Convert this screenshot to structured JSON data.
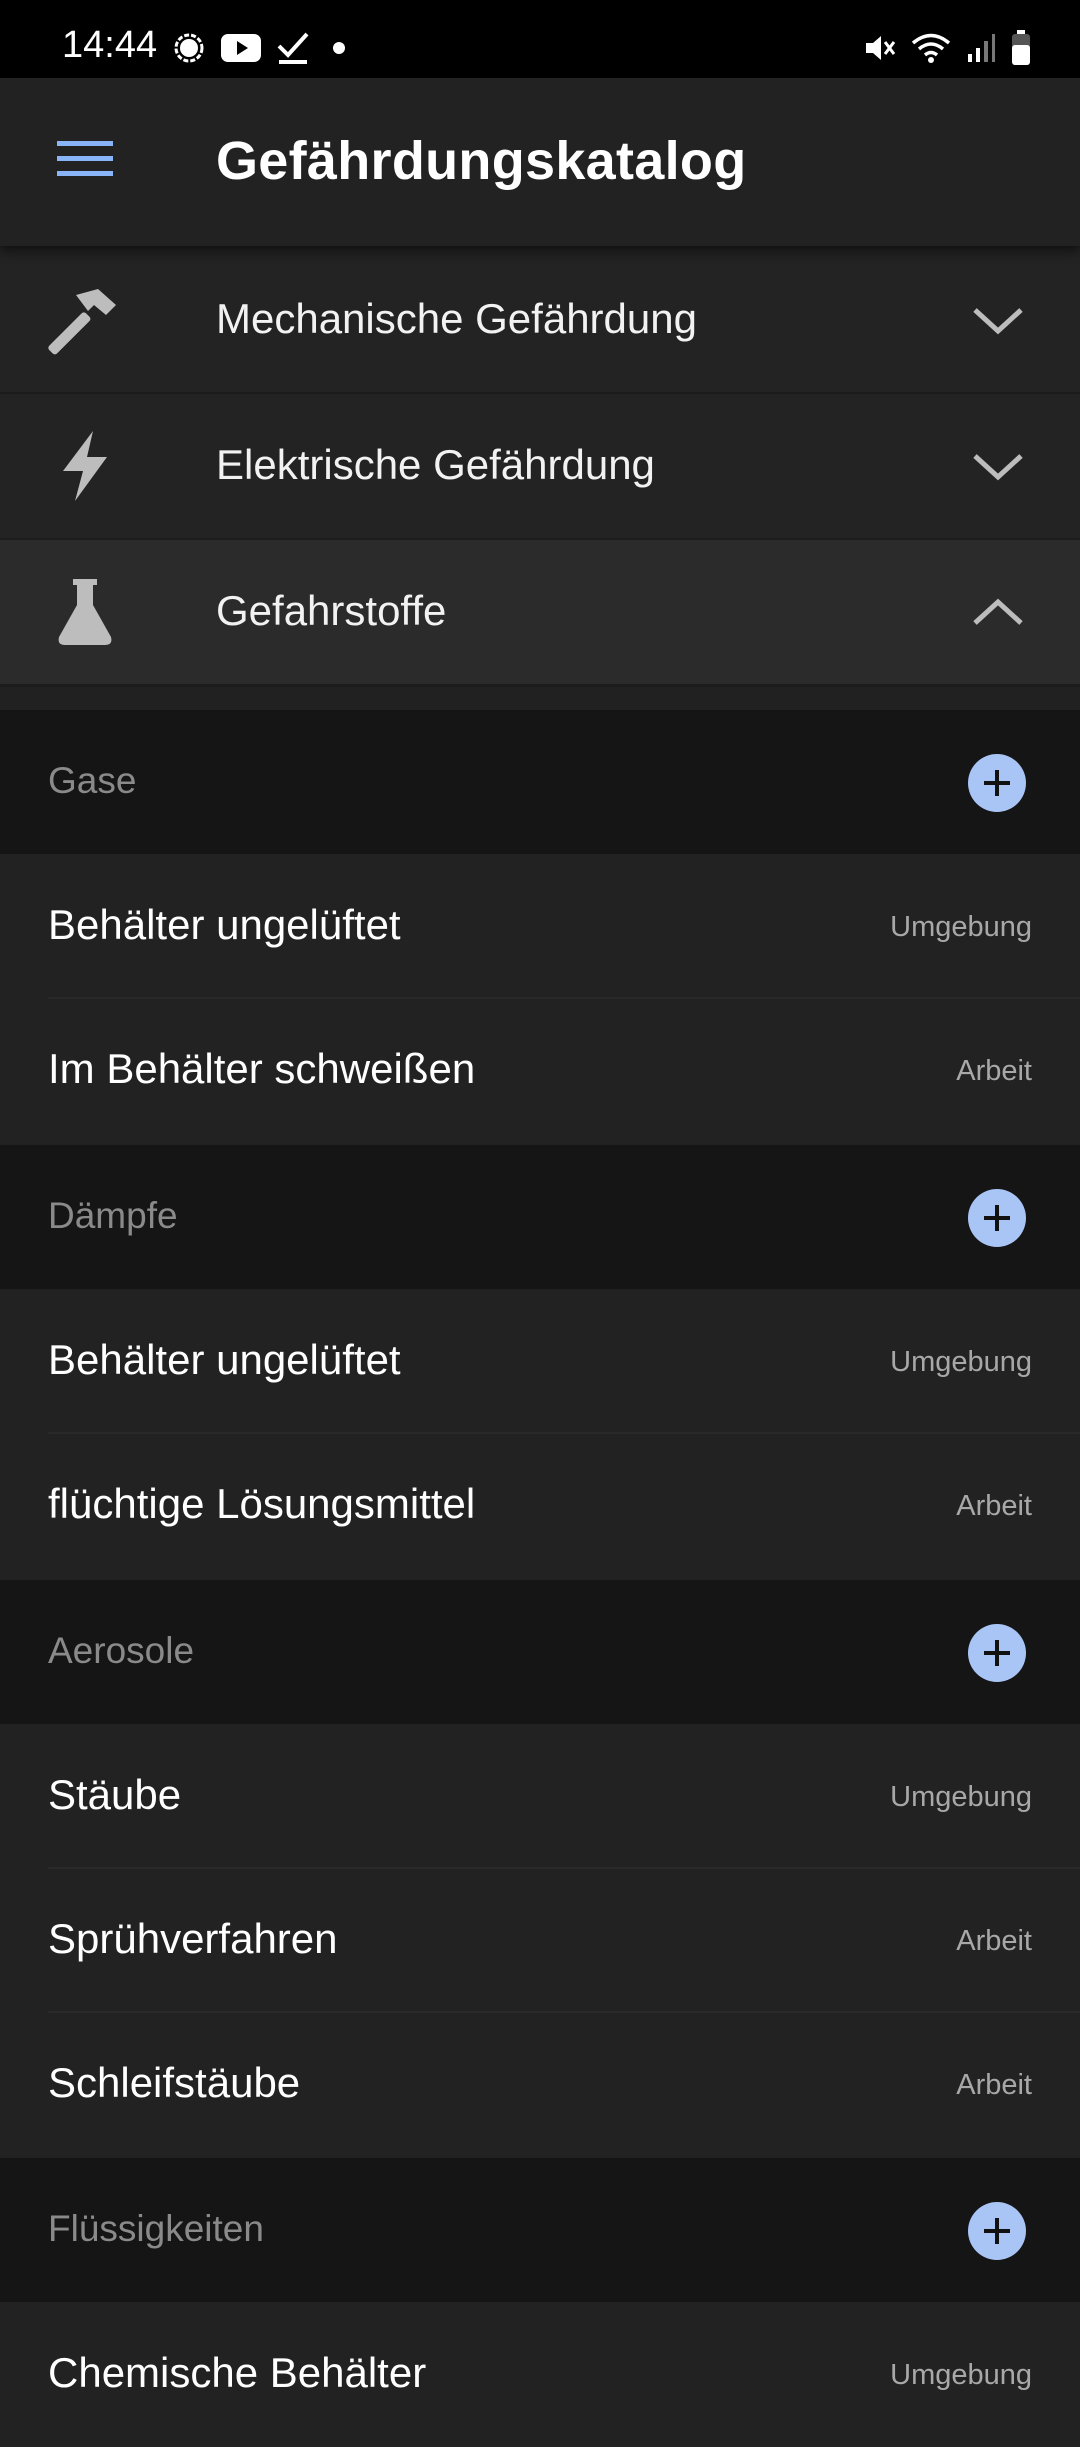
{
  "status_bar": {
    "time": "14:44",
    "left_icons": [
      "signal-messenger-icon",
      "youtube-icon",
      "check-icon",
      "dot-icon"
    ],
    "right_icons": [
      "mute-icon",
      "wifi-icon",
      "cell-signal-icon",
      "battery-icon"
    ]
  },
  "app_bar": {
    "menu_icon": "hamburger-menu-icon",
    "title": "Gefährdungskatalog",
    "accent_color": "#8ab4f8"
  },
  "categories": [
    {
      "label": "Mechanische Gefährdung",
      "icon": "hammer-icon",
      "expanded": false
    },
    {
      "label": "Elektrische Gefährdung",
      "icon": "lightning-icon",
      "expanded": false
    },
    {
      "label": "Gefahrstoffe",
      "icon": "flask-icon",
      "expanded": true
    }
  ],
  "sections": [
    {
      "title": "Gase",
      "items": [
        {
          "label": "Behälter ungelüftet",
          "tag": "Umgebung"
        },
        {
          "label": "Im Behälter schweißen",
          "tag": "Arbeit"
        }
      ]
    },
    {
      "title": "Dämpfe",
      "items": [
        {
          "label": "Behälter ungelüftet",
          "tag": "Umgebung"
        },
        {
          "label": "flüchtige Lösungsmittel",
          "tag": "Arbeit"
        }
      ]
    },
    {
      "title": "Aerosole",
      "items": [
        {
          "label": "Stäube",
          "tag": "Umgebung"
        },
        {
          "label": "Sprühverfahren",
          "tag": "Arbeit"
        },
        {
          "label": "Schleifstäube",
          "tag": "Arbeit"
        }
      ]
    },
    {
      "title": "Flüssigkeiten",
      "items": [
        {
          "label": "Chemische Behälter",
          "tag": "Umgebung"
        }
      ]
    }
  ],
  "colors": {
    "background": "#212121",
    "section_header_bg": "#151515",
    "add_button": "#a9c5f6",
    "muted_text": "#8a8a8a"
  }
}
